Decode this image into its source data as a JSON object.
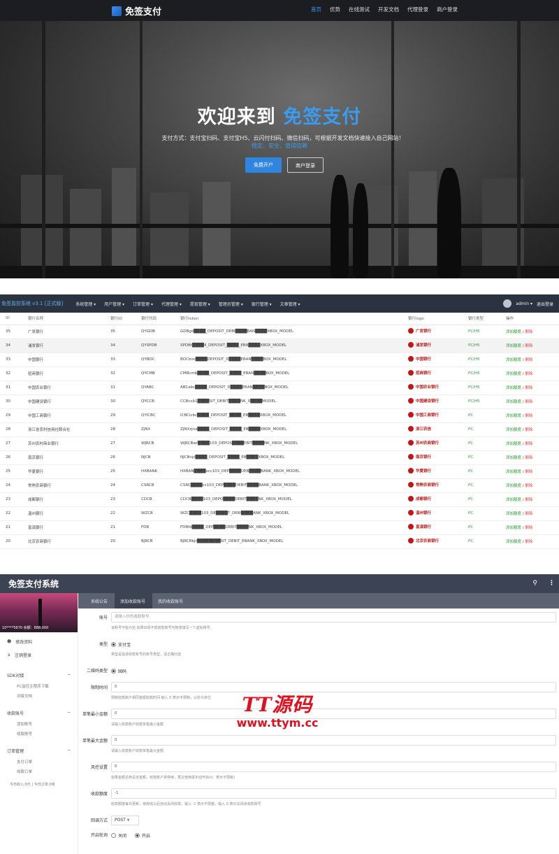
{
  "landing": {
    "logo": "免签支付",
    "nav": [
      "首页",
      "优势",
      "在线测试",
      "开发文档",
      "代理登录",
      "商户登录"
    ],
    "title_prefix": "欢迎来到",
    "title_highlight": "免签支付",
    "subtitle": "支付方式：支付宝扫码、支付宝H5、云闪付扫码、微信扫码，可根据开发文档快速接入自己网站！",
    "subtitle2": "稳定、安全、值得信赖",
    "btn_register": "免费开户",
    "btn_login": "商户登录"
  },
  "admin": {
    "brand": "免签监控系统 v3.1 [正式版]",
    "menus": [
      "系统管理 ▾",
      "用户管理 ▾",
      "订单管理 ▾",
      "代理管理 ▾",
      "提现管理 ▾",
      "管理员管理 ▾",
      "银行管理 ▾",
      "文章管理 ▾"
    ],
    "user": "admin ▾",
    "logout": "退出登录",
    "columns": [
      "ID",
      "银行名称",
      "银行ID",
      "银行代码",
      "银行token",
      "银行logo",
      "银行类型",
      "操作"
    ],
    "rows": [
      {
        "id": "35",
        "name": "广发银行",
        "bid": "35",
        "code": "QYGDB",
        "token": "GDBgd████_DEPOSIT_DEBI████BAN████XBOX_MODEL",
        "logo": "广发银行",
        "type": "PC/H5"
      },
      {
        "id": "34",
        "name": "浦发银行",
        "bid": "34",
        "code": "QYSPDB",
        "token": "SPDBt████4_DEPOSIT_████_EBA████XBOX_MODEL",
        "logo": "浦发银行",
        "type": "PC/H5"
      },
      {
        "id": "33",
        "name": "中国银行",
        "bid": "33",
        "code": "QYBOC",
        "token": "BOCboc████DEPOSIT_D████EBAN████BOX_MODEL",
        "logo": "中国银行",
        "type": "PC/H5"
      },
      {
        "id": "32",
        "name": "招商银行",
        "bid": "32",
        "code": "QYCMB",
        "token": "CMBcmb████_DEPOSIT_████_EBAN████BOX_MODEL",
        "logo": "招商银行",
        "type": "PC/H5"
      },
      {
        "id": "31",
        "name": "中国农业银行",
        "bid": "31",
        "code": "QYABC",
        "token": "ABCabc████_DEPOSIT_D████EBAN████BOX_MODEL",
        "logo": "中国农业银行",
        "type": "PC/H5"
      },
      {
        "id": "30",
        "name": "中国建设银行",
        "bid": "30",
        "code": "QYCCB",
        "token": "CCBccb1████SIT_DEBIT████NK_X████MODEL",
        "logo": "中国建设银行",
        "type": "PC/H5"
      },
      {
        "id": "29",
        "name": "中国工商银行",
        "bid": "29",
        "code": "QYICBC",
        "token": "ICBCicbc████_DEPOSIT_████_EB████XBOX_MODEL",
        "logo": "中国工商银行",
        "type": "PC"
      },
      {
        "id": "28",
        "name": "浙江省农村信用社联合社",
        "bid": "28",
        "code": "ZJNX",
        "token": "ZJNXzjnx████_DEPOSIT_████_EB████XBOX_MODEL",
        "logo": "浙江农信",
        "type": "PC"
      },
      {
        "id": "27",
        "name": "苏州农村商业银行",
        "bid": "27",
        "code": "WJRCB",
        "token": "WJRCBwr████103_DEPOS████EBIT████NK_XBOX_MODEL",
        "logo": "苏州农商银行",
        "type": "PC"
      },
      {
        "id": "26",
        "name": "南京银行",
        "bid": "26",
        "code": "NJCB",
        "token": "NJCBnjc████_DEPOSIT_████_EB████XBOX_MODEL",
        "logo": "南京银行",
        "type": "PC"
      },
      {
        "id": "25",
        "name": "华夏银行",
        "bid": "25",
        "code": "HXBANK",
        "token": "HXBAN████xcc103_DEP████DEB████BANK_XBOX_MODEL",
        "logo": "华夏银行",
        "type": "PC"
      },
      {
        "id": "24",
        "name": "常熟农商银行",
        "bid": "24",
        "code": "CSRCB",
        "token": "CSRC████cc103_DEP████DEBIT████BANK_XBOX_MODEL",
        "logo": "常熟农商银行",
        "type": "PC"
      },
      {
        "id": "23",
        "name": "成都银行",
        "bid": "23",
        "code": "CDCB",
        "token": "CDCB████103_DEPO████DEBIT████NK_XBOX_MODEL",
        "logo": "成都银行",
        "type": "PC"
      },
      {
        "id": "22",
        "name": "温州银行",
        "bid": "22",
        "code": "WZCB",
        "token": "WZC████103_DE████T_DEBI████ANK_XBOX_MODEL",
        "logo": "温州银行",
        "type": "PC"
      },
      {
        "id": "21",
        "name": "富滇银行",
        "bid": "21",
        "code": "FDB",
        "token": "FDBfd████_DEP████DEBIT████NK_XBOX_MODEL",
        "logo": "富滇银行",
        "type": "PC"
      },
      {
        "id": "20",
        "name": "北京农商银行",
        "bid": "20",
        "code": "BJRCB",
        "token": "BJRCBbjr████████SIT_DEBIT_EBANK_XBOX_MODEL",
        "logo": "北京农商银行",
        "type": "PC"
      }
    ],
    "op_add": "添加额度",
    "op_sep": " / ",
    "op_del": "删除"
  },
  "system": {
    "title": "免签支付系统",
    "account": "10****5670 余额：888.000",
    "side_items": [
      "修改资料",
      "注销登录"
    ],
    "sections": [
      {
        "label": "SDK对接",
        "subs": [
          "PC监控主程序下载",
          "对接文档"
        ]
      },
      {
        "label": "收款账号",
        "subs": [
          "添加账号",
          "收款账号"
        ]
      },
      {
        "label": "订单管理",
        "subs": [
          "支付订单",
          "收款订单"
        ]
      }
    ],
    "stats_prefix": "今日收入:",
    "stats_income": "0",
    "stats_mid": "元 | 今日订单:",
    "stats_orders": "0",
    "stats_suffix": "单",
    "tabs": [
      "系统公告",
      "添加收款账号",
      "我的收款账号"
    ],
    "fields": {
      "account_label": "账号",
      "account_ph": "请输入你的收款账号",
      "account_help": "该账号不能为空,如果出现不想收款账号可随意填写一个虚拟账号",
      "type_label": "类型",
      "type_value": "支付宝",
      "type_help": "类型是指该收款账号的账号类型，请正确归选",
      "qr_label": "二维码类型",
      "qr_value": "固码",
      "limit_label": "限制时间",
      "limit_value": "0",
      "limit_help": "限制收款账户相同金额收款时间 输入 0 表示不限制，以秒为单位",
      "min_label": "单笔最小金额",
      "min_value": "0",
      "min_help": "请输入收款账户收款单笔最小金额",
      "max_label": "单笔最大金额",
      "max_value": "0",
      "max_help": "请输入收款账户收款单笔最大金额",
      "risk_label": "风控设置",
      "risk_value": "0",
      "risk_help": "如果金额达到设定金额，收款账户将停用，再次使用需手动开启(0：表示不限制)",
      "quota_label": "收款额度",
      "quota_value": "-1",
      "quota_help": "收款额度每日更新，使用完以后自动关闭收款。输入 -1 表示不限额，输入 0 表示关闭该收款账号",
      "callback_label": "回调方式",
      "callback_value": "POST",
      "polling_label": "开启轮询",
      "polling_off": "关闭",
      "polling_on": "开启"
    }
  },
  "watermark": {
    "line1": "TT源码",
    "line2": "www.ttym.cc"
  }
}
